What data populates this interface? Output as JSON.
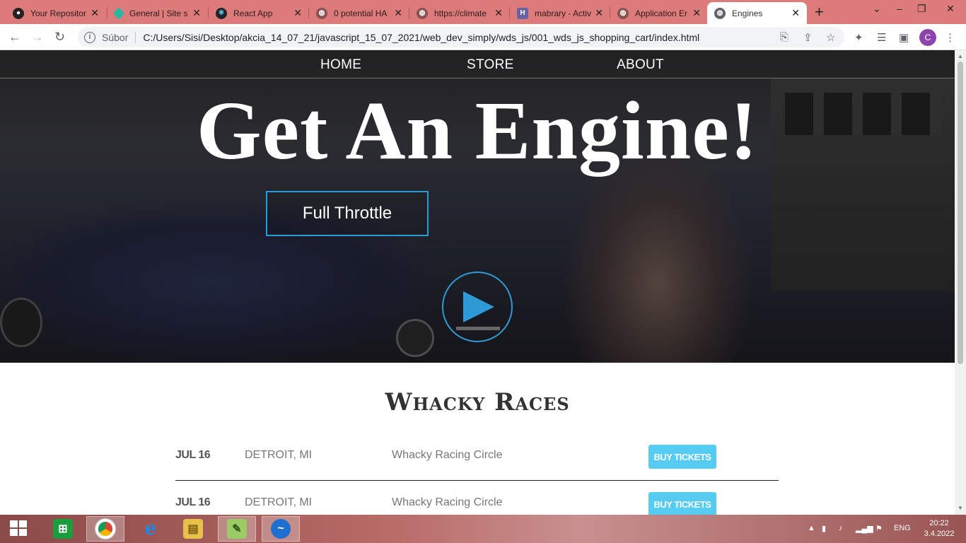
{
  "browser": {
    "tabs": [
      {
        "title": "Your Repositor",
        "favicon": "github-icon",
        "active": false
      },
      {
        "title": "General | Site s",
        "favicon": "diamond-icon",
        "active": false
      },
      {
        "title": "React App",
        "favicon": "react-icon",
        "active": false
      },
      {
        "title": "0 potential HA",
        "favicon": "globe-icon",
        "active": false
      },
      {
        "title": "https://climate",
        "favicon": "globe-icon",
        "active": false
      },
      {
        "title": "mabrary - Activ",
        "favicon": "heroku-icon",
        "active": false
      },
      {
        "title": "Application Er",
        "favicon": "globe-icon",
        "active": false
      },
      {
        "title": "Engines",
        "favicon": "globe-icon",
        "active": true
      }
    ],
    "scheme_label": "Súbor",
    "url": "C:/Users/Sisi/Desktop/akcia_14_07_21/javascript_15_07_2021/web_dev_simply/wds_js/001_wds_js_shopping_cart/index.html",
    "profile_initial": "C"
  },
  "page": {
    "nav": [
      "HOME",
      "STORE",
      "ABOUT"
    ],
    "hero_title": "Get An Engine!",
    "cta_label": "Full Throttle",
    "section_title": "Whacky Races",
    "tour_rows": [
      {
        "date": "JUL 16",
        "city": "DETROIT, MI",
        "venue": "Whacky Racing Circle",
        "button": "BUY TICKETS"
      },
      {
        "date": "JUL 16",
        "city": "DETROIT, MI",
        "venue": "Whacky Racing Circle",
        "button": "BUY TICKETS"
      }
    ]
  },
  "taskbar": {
    "apps": [
      "windows-store-icon",
      "chrome-icon",
      "internet-explorer-icon",
      "file-explorer-icon",
      "notepad-plus-plus-icon",
      "blue-app-icon"
    ],
    "language": "ENG",
    "time": "20:22",
    "date": "3.4.2022"
  },
  "colors": {
    "tabstrip": "#dd7a7a",
    "accent_blue": "#2d9ad6",
    "buy_button": "#56ccf2"
  }
}
